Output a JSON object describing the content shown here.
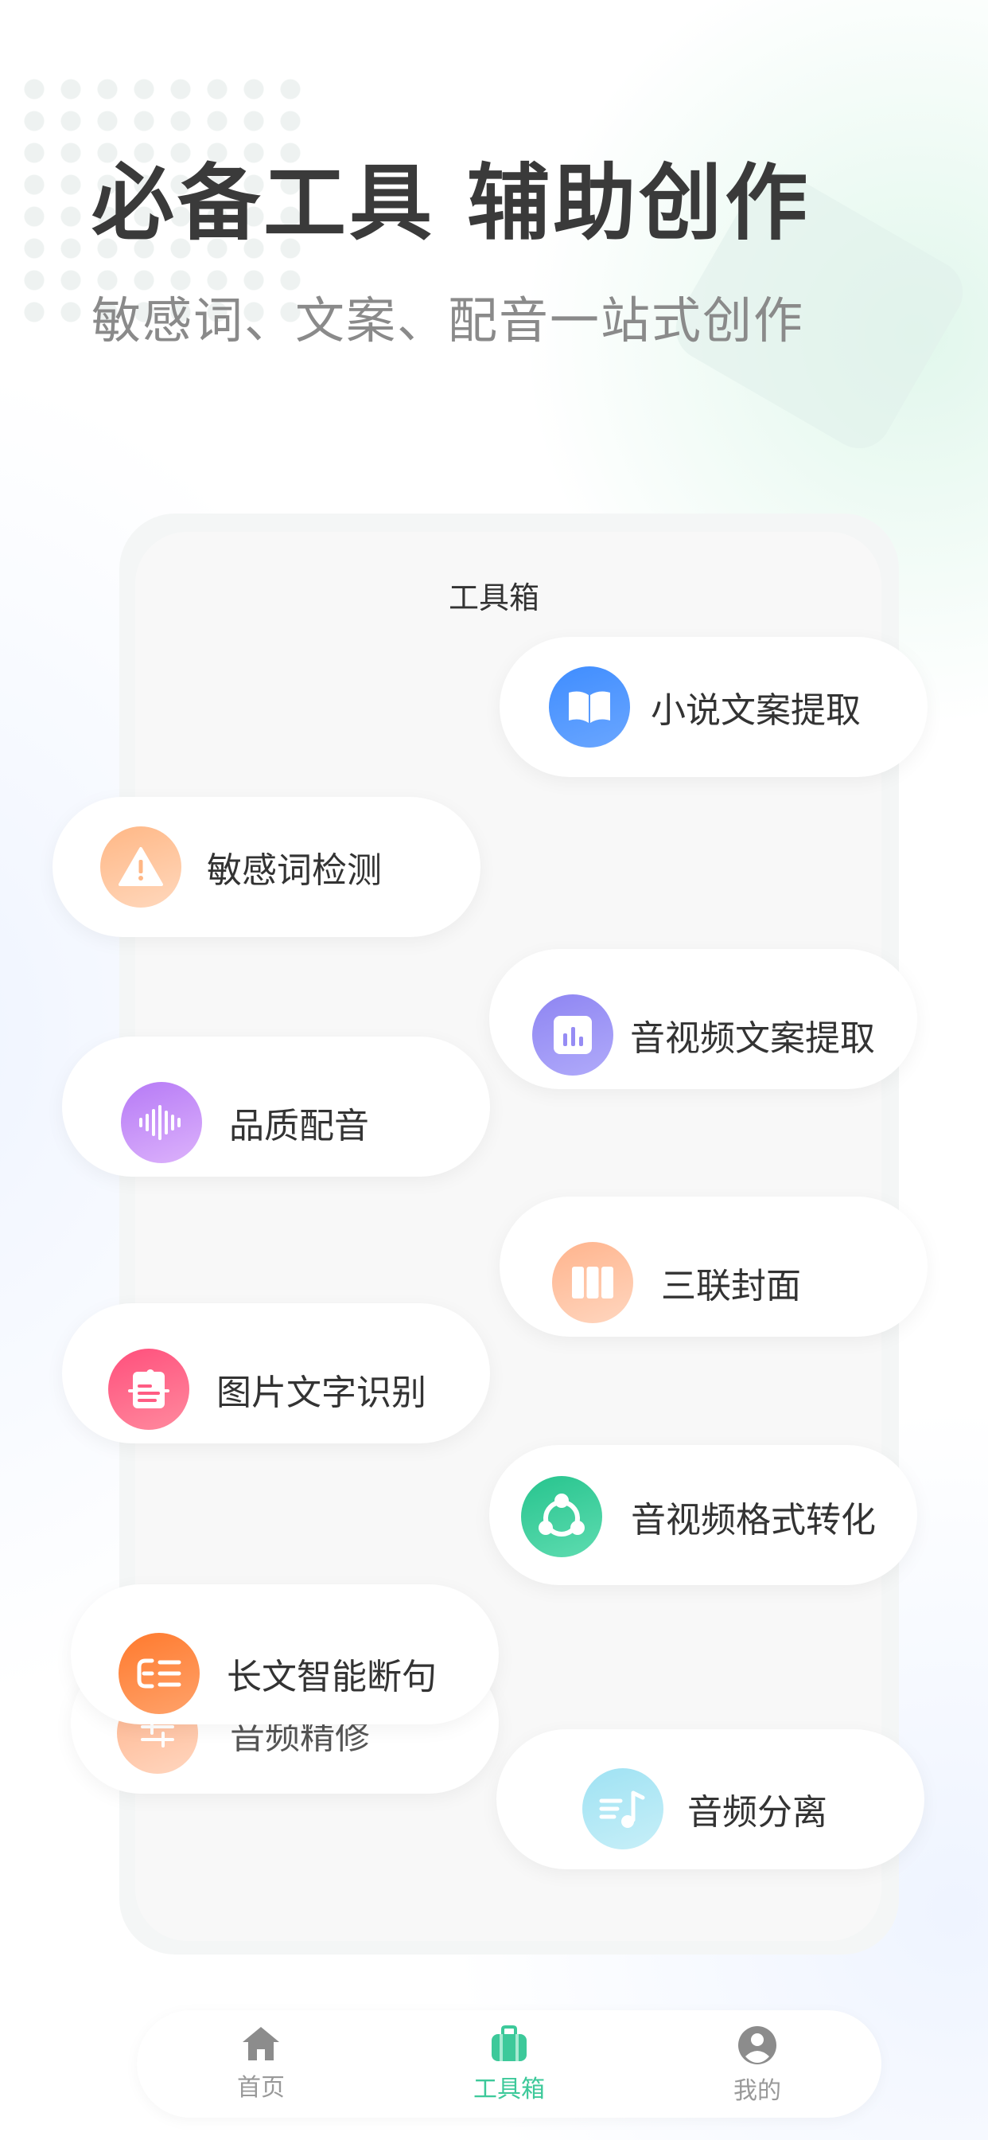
{
  "hero": {
    "title": "必备工具 辅助创作",
    "subtitle": "敏感词、文案、配音一站式创作"
  },
  "panel": {
    "title": "工具箱"
  },
  "tools": [
    {
      "label": "小说文案提取",
      "icon": "book-icon",
      "color": "#4a93ff"
    },
    {
      "label": "敏感词检测",
      "icon": "warning-icon",
      "color": "#ffbf93"
    },
    {
      "label": "音视频文案提取",
      "icon": "bar-chart-icon",
      "color": "#968cf4"
    },
    {
      "label": "品质配音",
      "icon": "sound-wave-icon",
      "color": "#c490f8"
    },
    {
      "label": "三联封面",
      "icon": "triptych-icon",
      "color": "#ffbd98"
    },
    {
      "label": "图片文字识别",
      "icon": "ocr-document-icon",
      "color": "#ff5c83"
    },
    {
      "label": "音视频格式转化",
      "icon": "convert-cycle-icon",
      "color": "#33c995"
    },
    {
      "label": "音频精修",
      "icon": "audio-edit-icon",
      "color": "#ffbd98"
    },
    {
      "label": "长文智能断句",
      "icon": "sentence-split-icon",
      "color": "#ff8238"
    },
    {
      "label": "音频分离",
      "icon": "music-note-icon",
      "color": "#ade6f5"
    }
  ],
  "nav": {
    "items": [
      {
        "label": "首页",
        "icon": "home-icon"
      },
      {
        "label": "工具箱",
        "icon": "toolbox-icon",
        "active": true
      },
      {
        "label": "我的",
        "icon": "profile-icon"
      }
    ],
    "active_color": "#3dc99a"
  }
}
